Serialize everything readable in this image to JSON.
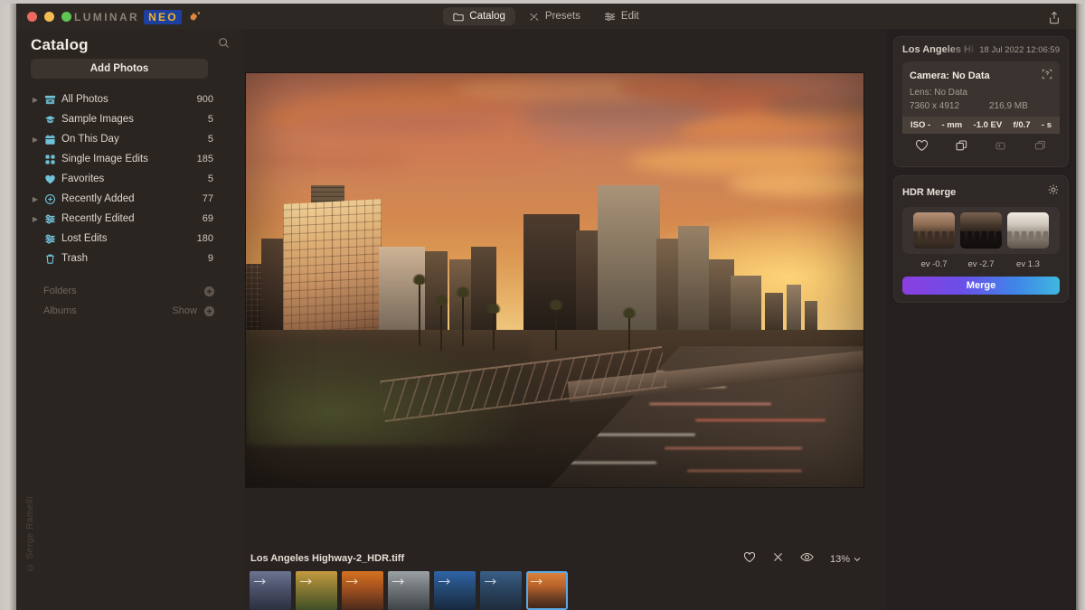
{
  "app": {
    "brand_primary": "LUMINAR",
    "brand_secondary": "NEO",
    "brand_badge_icon": "puzzle-piece-icon",
    "accent_blue": "#1d3f9e",
    "accent_yellow": "#f0b429"
  },
  "titlebar": {
    "share_icon": "share-export-icon",
    "tabs": [
      {
        "label": "Catalog",
        "icon": "folder-icon",
        "active": true
      },
      {
        "label": "Presets",
        "icon": "sparkle-icon",
        "active": false
      },
      {
        "label": "Edit",
        "icon": "sliders-icon",
        "active": false
      }
    ]
  },
  "sidebar": {
    "title": "Catalog",
    "search_icon": "search-icon",
    "add_photos_label": "Add Photos",
    "items": [
      {
        "label": "All Photos",
        "count": "900",
        "icon": "archive-icon",
        "expandable": true
      },
      {
        "label": "Sample Images",
        "count": "5",
        "icon": "graduation-icon",
        "expandable": false
      },
      {
        "label": "On This Day",
        "count": "5",
        "icon": "calendar-icon",
        "expandable": true
      },
      {
        "label": "Single Image Edits",
        "count": "185",
        "icon": "grid-icon",
        "expandable": false
      },
      {
        "label": "Favorites",
        "count": "5",
        "icon": "heart-icon",
        "expandable": false
      },
      {
        "label": "Recently Added",
        "count": "77",
        "icon": "plus-circle-icon",
        "expandable": true
      },
      {
        "label": "Recently Edited",
        "count": "69",
        "icon": "sliders-icon",
        "expandable": true
      },
      {
        "label": "Lost Edits",
        "count": "180",
        "icon": "sliders-icon",
        "expandable": false
      },
      {
        "label": "Trash",
        "count": "9",
        "icon": "trash-icon",
        "expandable": false
      }
    ],
    "sections": [
      {
        "label": "Folders",
        "show_label": "",
        "add_icon": "plus-circle-icon"
      },
      {
        "label": "Albums",
        "show_label": "Show",
        "add_icon": "plus-circle-icon"
      }
    ],
    "watermark": "© Serge Ramelli"
  },
  "bottombar": {
    "filename": "Los Angeles Highway-2_HDR.tiff",
    "favorite_icon": "heart-icon",
    "reject_icon": "close-icon",
    "preview_icon": "eye-icon",
    "zoom_level": "13%",
    "zoom_chevron_icon": "chevron-down-icon",
    "filmstrip": [
      {
        "name": "thumb-dusk-street",
        "selected": false,
        "c1": "#6b7490",
        "c2": "#2c2f3e",
        "badge": "arrow-icon"
      },
      {
        "name": "thumb-autumn-park",
        "selected": false,
        "c1": "#c49a3f",
        "c2": "#3f5027",
        "badge": "arrow-icon"
      },
      {
        "name": "thumb-orange-sunset",
        "selected": false,
        "c1": "#d4711f",
        "c2": "#4a2a1c",
        "badge": "arrow-icon"
      },
      {
        "name": "thumb-gray-coast",
        "selected": false,
        "c1": "#9aa0a4",
        "c2": "#4a5054",
        "badge": "arrow-icon"
      },
      {
        "name": "thumb-blue-harbor",
        "selected": false,
        "c1": "#2f64a8",
        "c2": "#16283f",
        "badge": "arrow-icon"
      },
      {
        "name": "thumb-blue-hills",
        "selected": false,
        "c1": "#3a5f86",
        "c2": "#1e2c3c",
        "badge": "arrow-icon"
      },
      {
        "name": "thumb-la-skyline",
        "selected": true,
        "c1": "#e0853c",
        "c2": "#3a2418",
        "badge": "arrow-icon"
      }
    ]
  },
  "rightpanel": {
    "photo_name": "Los Angeles Hi",
    "photo_date": "18 Jul 2022 12:06:59",
    "exif": {
      "camera": "Camera: No Data",
      "help_icon": "question-box-icon",
      "lens": "Lens: No Data",
      "dimensions": "7360 x 4912",
      "filesize": "216,9 MB",
      "iso": "ISO -",
      "focal": "- mm",
      "ev": "-1.0 EV",
      "aperture": "f/0.7",
      "shutter": "- s"
    },
    "action_icons": [
      {
        "name": "heart-icon",
        "enabled": true
      },
      {
        "name": "copy-icon",
        "enabled": true
      },
      {
        "name": "rotate-icon",
        "enabled": false
      },
      {
        "name": "compare-icon",
        "enabled": false
      }
    ],
    "hdr": {
      "title": "HDR Merge",
      "settings_icon": "gear-icon",
      "brackets": [
        {
          "ev": "ev -0.7",
          "tone": "mid"
        },
        {
          "ev": "ev -2.7",
          "tone": "dark"
        },
        {
          "ev": "ev 1.3",
          "tone": "bright"
        }
      ],
      "merge_label": "Merge",
      "merge_gradient_from": "#8b3fe0",
      "merge_gradient_to": "#3fb7e0"
    }
  }
}
